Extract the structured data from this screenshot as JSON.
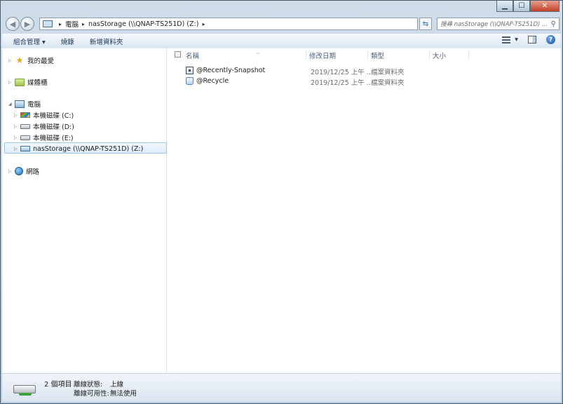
{
  "window": {
    "buttons": {
      "minimize": "▁",
      "maximize": "☐",
      "close": "✕"
    }
  },
  "navigation": {
    "back_glyph": "◀",
    "forward_glyph": "▶",
    "address": {
      "crumbs": [
        "電腦",
        "nasStorage (\\\\QNAP-TS251D) (Z:)"
      ],
      "separator": "▸"
    },
    "refresh_glyph": "⇆",
    "search_placeholder": "搜尋 nasStorage (\\\\QNAP-TS251D) ...",
    "search_icon_glyph": "⚲"
  },
  "toolbar": {
    "organize": "組合管理 ▾",
    "burn": "燒錄",
    "new_folder": "新增資料夾",
    "view_menu_arrow": "▾",
    "help_glyph": "?"
  },
  "nav_tree": {
    "favorites": "我的最愛",
    "libraries": "媒體櫃",
    "computer": "電腦",
    "drive_c": "本機磁碟 (C:)",
    "drive_d": "本機磁碟 (D:)",
    "drive_e": "本機磁碟 (E:)",
    "drive_z": "nasStorage (\\\\QNAP-TS251D) (Z:)",
    "network": "網路",
    "collapsed_arrow": "▷",
    "expanded_arrow": "◢",
    "star_glyph": "★"
  },
  "file_list": {
    "columns": {
      "name": "名稱",
      "modified": "修改日期",
      "type": "類型",
      "size": "大小"
    },
    "sort_arrow": "︿",
    "rows": [
      {
        "name": "@Recently-Snapshot",
        "modified": "2019/12/25 上午 ...",
        "type": "檔案資料夾",
        "size": ""
      },
      {
        "name": "@Recycle",
        "modified": "2019/12/25 上午 ...",
        "type": "檔案資料夾",
        "size": ""
      }
    ]
  },
  "status": {
    "item_count": "2 個項目",
    "connection_label": "離線狀態:",
    "connection_value": "上線",
    "availability_label": "離線可用性:",
    "availability_value": "無法使用"
  }
}
